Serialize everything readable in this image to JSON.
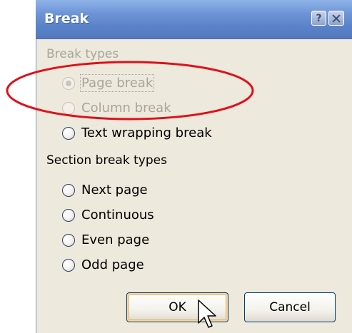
{
  "dialog": {
    "title": "Break",
    "help_glyph": "?",
    "close_icon": "close-icon"
  },
  "break_types": {
    "label": "Break types",
    "options": [
      {
        "label": "Page break",
        "disabled": true,
        "selected": true
      },
      {
        "label": "Column break",
        "disabled": true,
        "selected": false
      },
      {
        "label": "Text wrapping break",
        "disabled": false,
        "selected": false
      }
    ]
  },
  "section_break_types": {
    "label": "Section break types",
    "options": [
      {
        "label": "Next page"
      },
      {
        "label": "Continuous"
      },
      {
        "label": "Even page"
      },
      {
        "label": "Odd page"
      }
    ]
  },
  "buttons": {
    "ok_label": "OK",
    "cancel_label": "Cancel"
  },
  "annotation": {
    "color": "#e0101a"
  }
}
